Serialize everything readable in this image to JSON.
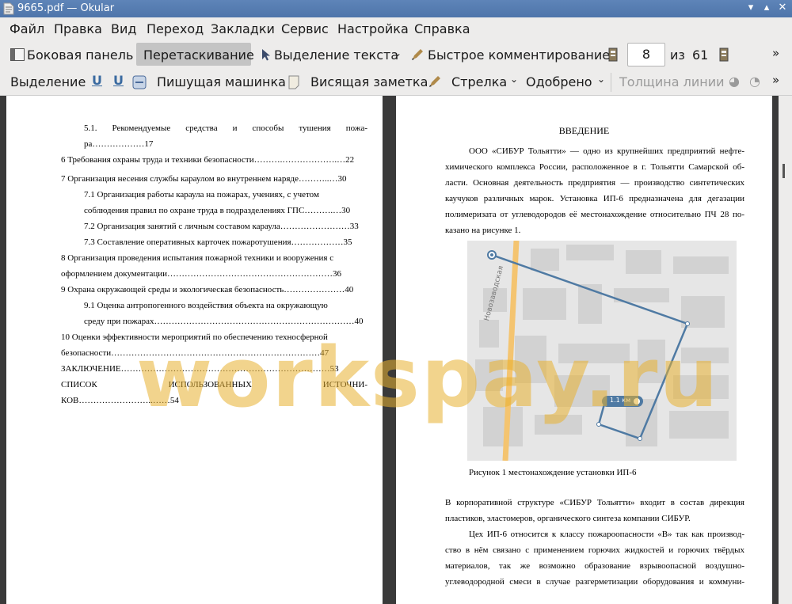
{
  "window": {
    "title": "9665.pdf  — Okular"
  },
  "menu": [
    "Файл",
    "Правка",
    "Вид",
    "Переход",
    "Закладки",
    "Сервис",
    "Настройка",
    "Справка"
  ],
  "toolbar1": {
    "sidebar": "Боковая панель",
    "drag": "Перетаскивание",
    "text_select": "Выделение текста",
    "quick_comment": "Быстрое комментирование",
    "page_current": "8",
    "page_of": "из",
    "page_total": "61"
  },
  "toolbar2": {
    "highlight": "Выделение",
    "typewriter": "Пишущая машинка",
    "hanging_note": "Висящая заметка",
    "arrow": "Стрелка",
    "approved": "Одобрено",
    "line_width": "Толщина линии"
  },
  "left_page": {
    "toc": [
      {
        "a": "5.1.  Рекомендуемые  средства  и  способы  тушения  пожа-"
      },
      {
        "a": "ра………………17"
      },
      {
        "a": "6 Требования охраны труда и техники безопасности……….……………….…22"
      },
      {
        "a": "7 Организация несения службы караулом во внутреннем наряде………..…30"
      },
      {
        "a": "7.1 Организация работы караула на пожарах, учениях, с учетом"
      },
      {
        "a": "соблюдения правил по охране труда в подразделениях ГПС……….…30"
      },
      {
        "a": "7.2 Организация занятий с личным составом караула……………………33"
      },
      {
        "a": "7.3 Составление оперативных карточек пожаротушения………………35"
      },
      {
        "a": "8 Организация проведения испытания пожарной техники и вооружения с"
      },
      {
        "a": "оформлением документации…………………………………………………36"
      },
      {
        "a": "9 Охрана окружающей среды и экологическая безопасность…………………40"
      },
      {
        "a": "9.1 Оценка антропогенного воздействия объекта на окружающую"
      },
      {
        "a": "среду при пожарах……………………………………………………………40"
      },
      {
        "a": "10 Оценки эффективности мероприятий по обеспечению техносферной"
      },
      {
        "a": "безопасности………………………………………………………………47"
      },
      {
        "a": "ЗАКЛЮЧЕНИЕ………………………………………………………………53"
      },
      {
        "a": "СПИСОК          ИСПОЛЬЗОВАННЫХ          ИСТОЧНИ-"
      },
      {
        "a": "КОВ……………………..……54"
      }
    ]
  },
  "right_page": {
    "heading": "ВВЕДЕНИЕ",
    "para1": [
      "ООО «СИБУР Тольятти» — одно из крупнейших предприятий нефте-",
      "химического комплекса России, расположенное в г. Тольятти Самарской об-",
      "ласти. Основная деятельность предприятия — производство синтетических",
      "каучуков различных марок. Установка ИП-6 предназначена для дегазации",
      "полимеризата от углеводородов её местонахождение относительно ПЧ 28 по-",
      "казано на рисунке 1."
    ],
    "map_street": "Новозаводская",
    "map_distance": "1.1 км",
    "caption": "Рисунок 1 местонахождение установки ИП-6",
    "para2": [
      "В корпоративной структуре «СИБУР Тольятти» входит в состав дирекция",
      "пластиков, эластомеров, органического синтеза компании СИБУР."
    ],
    "para3": [
      "Цех ИП-6 относится к классу пожароопасности «В» так как производ-",
      "ство в нём связано с применением горючих жидкостей и горючих твёрдых",
      "материалов,  так  же  возможно  образование  взрывоопасной  воздушно-",
      "углеводородной смеси в случае разгерметизации оборудования и коммуни-"
    ]
  },
  "watermark": "workspay.ru"
}
